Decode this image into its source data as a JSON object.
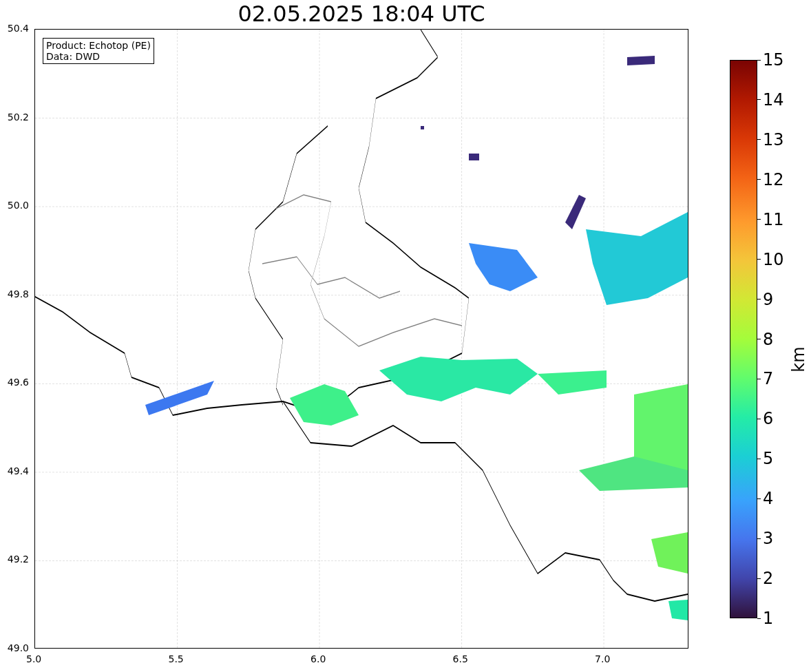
{
  "title": "02.05.2025 18:04 UTC",
  "legend": [
    "Product: Echotop (PE)",
    "Data: DWD"
  ],
  "x_ticks": [
    "5.0",
    "5.5",
    "6.0",
    "6.5",
    "7.0"
  ],
  "y_ticks": [
    "50.4",
    "50.2",
    "50.0",
    "49.8",
    "49.6",
    "49.4",
    "49.2",
    "49.0"
  ],
  "colorbar": {
    "label": "km",
    "ticks": [
      "15",
      "14",
      "13",
      "12",
      "11",
      "10",
      "9",
      "8",
      "7",
      "6",
      "5",
      "4",
      "3",
      "2",
      "1"
    ]
  }
}
